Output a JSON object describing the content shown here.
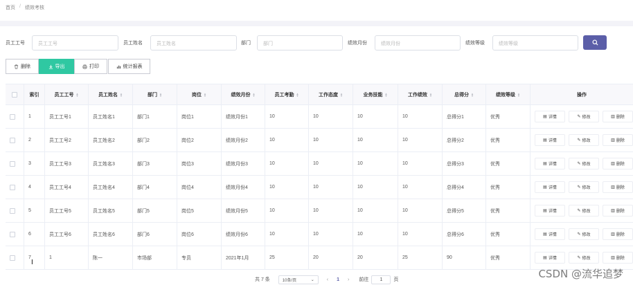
{
  "breadcrumb": {
    "home": "首页",
    "current": "绩效考核",
    "sep": "/"
  },
  "search": {
    "fields": [
      {
        "label": "员工工号",
        "placeholder": "员工工号"
      },
      {
        "label": "员工姓名",
        "placeholder": "员工姓名"
      },
      {
        "label": "部门",
        "placeholder": "部门"
      },
      {
        "label": "绩效月份",
        "placeholder": "绩效月份"
      },
      {
        "label": "绩效等级",
        "placeholder": "绩效等级"
      }
    ],
    "search_icon": "search-icon"
  },
  "toolbar": {
    "delete": {
      "icon": "trash-icon",
      "label": "删除"
    },
    "export": {
      "icon": "export-icon",
      "label": "导出"
    },
    "print": {
      "icon": "printer-icon",
      "label": "打印"
    },
    "report": {
      "icon": "bar-chart-icon",
      "label": "统计报表"
    }
  },
  "table": {
    "columns": [
      "索引",
      "员工工号",
      "员工姓名",
      "部门",
      "岗位",
      "绩效月份",
      "员工考勤",
      "工作态度",
      "业务技能",
      "工作绩效",
      "总得分",
      "绩效等级",
      "操作"
    ],
    "rows": [
      [
        "1",
        "员工工号1",
        "员工姓名1",
        "部门1",
        "岗位1",
        "绩效月份1",
        "10",
        "10",
        "10",
        "10",
        "总得分1",
        "优秀"
      ],
      [
        "2",
        "员工工号2",
        "员工姓名2",
        "部门2",
        "岗位2",
        "绩效月份2",
        "10",
        "10",
        "10",
        "10",
        "总得分2",
        "优秀"
      ],
      [
        "3",
        "员工工号3",
        "员工姓名3",
        "部门3",
        "岗位3",
        "绩效月份3",
        "10",
        "10",
        "10",
        "10",
        "总得分3",
        "优秀"
      ],
      [
        "4",
        "员工工号4",
        "员工姓名4",
        "部门4",
        "岗位4",
        "绩效月份4",
        "10",
        "10",
        "10",
        "10",
        "总得分4",
        "优秀"
      ],
      [
        "5",
        "员工工号5",
        "员工姓名5",
        "部门5",
        "岗位5",
        "绩效月份5",
        "10",
        "10",
        "10",
        "10",
        "总得分5",
        "优秀"
      ],
      [
        "6",
        "员工工号6",
        "员工姓名6",
        "部门6",
        "岗位6",
        "绩效月份6",
        "10",
        "10",
        "10",
        "10",
        "总得分6",
        "优秀"
      ],
      [
        "7",
        "1",
        "陈一",
        "市场部",
        "专员",
        "2021年1月",
        "25",
        "20",
        "20",
        "25",
        "90",
        "优秀"
      ]
    ],
    "row_actions": {
      "detail": "详情",
      "edit": "修改",
      "delete": "删除"
    }
  },
  "pagination": {
    "total": "共 7 条",
    "page_size": "10条/页",
    "current_page": "1",
    "goto_label": "前往",
    "goto_value": "1",
    "page_unit": "页"
  },
  "watermark": "CSDN @流华追梦",
  "colors": {
    "primary": "#5b5ea8",
    "export_green": "#2fc8a2"
  }
}
